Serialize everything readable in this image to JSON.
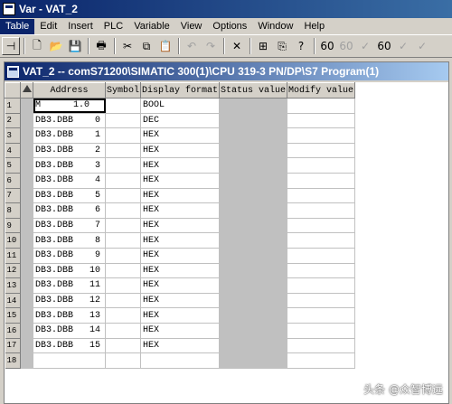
{
  "app": {
    "title": "Var - VAT_2"
  },
  "menu": [
    "Table",
    "Edit",
    "Insert",
    "PLC",
    "Variable",
    "View",
    "Options",
    "Window",
    "Help"
  ],
  "toolbar": {
    "buttons": [
      {
        "name": "pin-icon",
        "glyph": "⊣"
      },
      {
        "name": "new-icon",
        "glyph": "🗋"
      },
      {
        "name": "open-icon",
        "glyph": "📂"
      },
      {
        "name": "save-icon",
        "glyph": "💾"
      },
      {
        "name": "print-icon",
        "glyph": "🖶"
      },
      {
        "name": "cut-icon",
        "glyph": "✂"
      },
      {
        "name": "copy-icon",
        "glyph": "⧉"
      },
      {
        "name": "paste-icon",
        "glyph": "📋"
      },
      {
        "name": "undo-icon",
        "glyph": "↶"
      },
      {
        "name": "redo-icon",
        "glyph": "↷"
      },
      {
        "name": "delete-icon",
        "glyph": "✕"
      },
      {
        "name": "accessible-nodes-icon",
        "glyph": "⊞"
      },
      {
        "name": "online-icon",
        "glyph": "⎘"
      },
      {
        "name": "help-icon",
        "glyph": "?"
      },
      {
        "name": "monitor-variable-icon",
        "glyph": "60"
      },
      {
        "name": "monitor-variable-2-icon",
        "glyph": "60"
      },
      {
        "name": "modify-variable-icon",
        "glyph": "✓"
      },
      {
        "name": "update-monitor-icon",
        "glyph": "60"
      },
      {
        "name": "activate-modify-icon",
        "glyph": "✓"
      },
      {
        "name": "force-icon",
        "glyph": "✓"
      }
    ]
  },
  "inner_window": {
    "title": "VAT_2 -- comS71200\\SIMATIC 300(1)\\CPU 319-3 PN/DP\\S7 Program(1)"
  },
  "table": {
    "headers": [
      "Address",
      "Symbol",
      "Display format",
      "Status value",
      "Modify value"
    ],
    "rows": [
      {
        "num": "1",
        "address": "M      1.0",
        "symbol": "",
        "format": "BOOL"
      },
      {
        "num": "2",
        "address": "DB3.DBB    0",
        "symbol": "",
        "format": "DEC"
      },
      {
        "num": "3",
        "address": "DB3.DBB    1",
        "symbol": "",
        "format": "HEX"
      },
      {
        "num": "4",
        "address": "DB3.DBB    2",
        "symbol": "",
        "format": "HEX"
      },
      {
        "num": "5",
        "address": "DB3.DBB    3",
        "symbol": "",
        "format": "HEX"
      },
      {
        "num": "6",
        "address": "DB3.DBB    4",
        "symbol": "",
        "format": "HEX"
      },
      {
        "num": "7",
        "address": "DB3.DBB    5",
        "symbol": "",
        "format": "HEX"
      },
      {
        "num": "8",
        "address": "DB3.DBB    6",
        "symbol": "",
        "format": "HEX"
      },
      {
        "num": "9",
        "address": "DB3.DBB    7",
        "symbol": "",
        "format": "HEX"
      },
      {
        "num": "10",
        "address": "DB3.DBB    8",
        "symbol": "",
        "format": "HEX"
      },
      {
        "num": "11",
        "address": "DB3.DBB    9",
        "symbol": "",
        "format": "HEX"
      },
      {
        "num": "12",
        "address": "DB3.DBB   10",
        "symbol": "",
        "format": "HEX"
      },
      {
        "num": "13",
        "address": "DB3.DBB   11",
        "symbol": "",
        "format": "HEX"
      },
      {
        "num": "14",
        "address": "DB3.DBB   12",
        "symbol": "",
        "format": "HEX"
      },
      {
        "num": "15",
        "address": "DB3.DBB   13",
        "symbol": "",
        "format": "HEX"
      },
      {
        "num": "16",
        "address": "DB3.DBB   14",
        "symbol": "",
        "format": "HEX"
      },
      {
        "num": "17",
        "address": "DB3.DBB   15",
        "symbol": "",
        "format": "HEX"
      },
      {
        "num": "18",
        "address": "",
        "symbol": "",
        "format": ""
      }
    ]
  },
  "watermark": "头条 @众智博远"
}
